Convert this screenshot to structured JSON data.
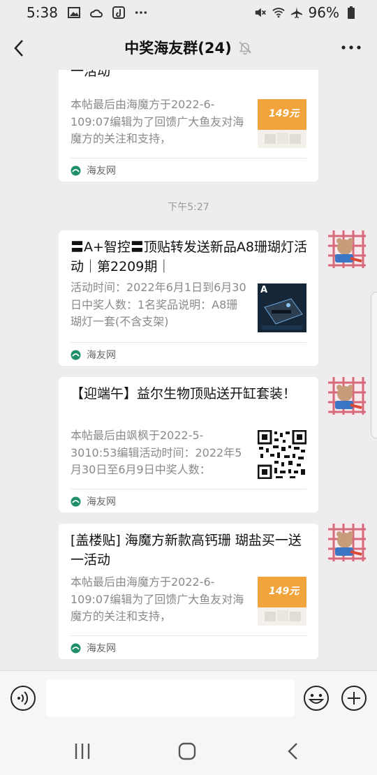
{
  "status_bar": {
    "time": "5:38",
    "battery": "96%"
  },
  "header": {
    "title": "中奖海友群(24)"
  },
  "chat": {
    "timestamp": "下午5:27",
    "messages": [
      {
        "title": "[盖楼贴] 海魔方新款高钙珊 瑚盐买一送一活动",
        "desc": "本帖最后由海魔方于2022-6-109:07编辑为了回馈广大鱼友对海魔方的关注和支持，",
        "source": "海友网",
        "thumb_text": "149元"
      },
      {
        "title": "〓A+智控〓顶贴转发送新品A8珊瑚灯活动｜第2209期｜",
        "desc": "活动时间：2022年6月1日到6月30日中奖人数：1名奖品说明：A8珊瑚灯一套(不含支架)",
        "source": "海友网",
        "thumb_text": "A"
      },
      {
        "title": "【迎端午】益尔生物顶贴送开缸套装！",
        "desc": "本帖最后由飒枫于2022-5-3010:53编辑活动时间：2022年5月30日至6月9日中奖人数：",
        "source": "海友网"
      },
      {
        "title": "[盖楼贴] 海魔方新款高钙珊 瑚盐买一送一活动",
        "desc": "本帖最后由海魔方于2022-6-109:07编辑为了回馈广大鱼友对海魔方的关注和支持，",
        "source": "海友网",
        "thumb_text": "149元"
      }
    ]
  },
  "input": {
    "placeholder": ""
  },
  "colors": {
    "background": "#ededed",
    "card": "#ffffff",
    "thumb_orange": "#f2a43c",
    "source_logo_green": "#1f8f6a"
  }
}
